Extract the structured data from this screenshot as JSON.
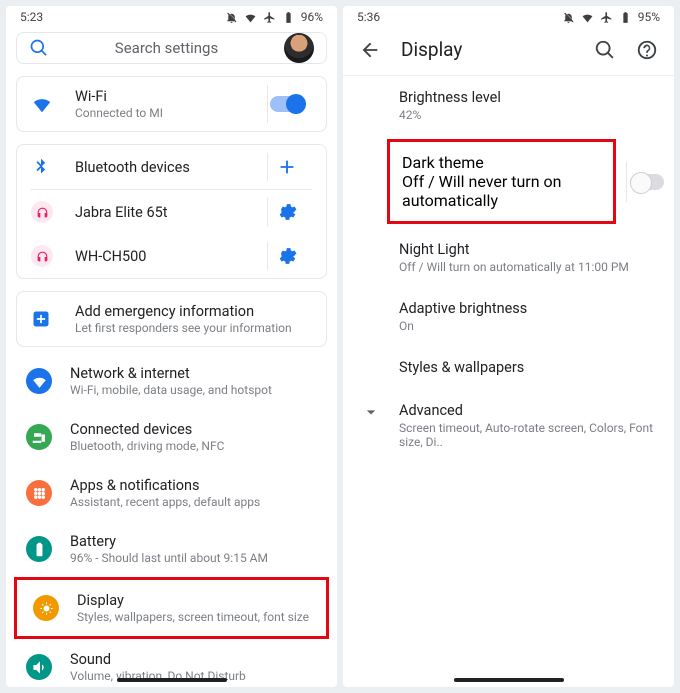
{
  "left": {
    "status": {
      "time": "5:23",
      "battery": "96%"
    },
    "search_placeholder": "Search settings",
    "wifi": {
      "title": "Wi-Fi",
      "sub": "Connected to MI"
    },
    "bluetooth_title": "Bluetooth devices",
    "bt_devices": [
      {
        "title": "Jabra Elite 65t"
      },
      {
        "title": "WH-CH500"
      }
    ],
    "emergency": {
      "title": "Add emergency information",
      "sub": "Let first responders see your information"
    },
    "items": [
      {
        "title": "Network & internet",
        "sub": "Wi-Fi, mobile, data usage, and hotspot",
        "color": "#1a73e8",
        "icon": "wifi"
      },
      {
        "title": "Connected devices",
        "sub": "Bluetooth, driving mode, NFC",
        "color": "#34a853",
        "icon": "devices"
      },
      {
        "title": "Apps & notifications",
        "sub": "Assistant, recent apps, default apps",
        "color": "#f9703e",
        "icon": "apps"
      },
      {
        "title": "Battery",
        "sub": "96% - Should last until about 9:15 AM",
        "color": "#009688",
        "icon": "battery"
      },
      {
        "title": "Display",
        "sub": "Styles, wallpapers, screen timeout, font size",
        "color": "#f29900",
        "icon": "display",
        "highlight": true
      },
      {
        "title": "Sound",
        "sub": "Volume, vibration, Do Not Disturb",
        "color": "#009688",
        "icon": "sound"
      }
    ]
  },
  "right": {
    "status": {
      "time": "5:36",
      "battery": "95%"
    },
    "header": "Display",
    "items": [
      {
        "title": "Brightness level",
        "sub": "42%"
      },
      {
        "title": "Dark theme",
        "sub": "Off / Will never turn on automatically",
        "toggle": "off",
        "highlight": true
      },
      {
        "title": "Night Light",
        "sub": "Off / Will turn on automatically at 11:00 PM"
      },
      {
        "title": "Adaptive brightness",
        "sub": "On"
      },
      {
        "title": "Styles & wallpapers",
        "sub": ""
      },
      {
        "title": "Advanced",
        "sub": "Screen timeout, Auto-rotate screen, Colors, Font size, Di..",
        "chevron": true
      }
    ]
  }
}
